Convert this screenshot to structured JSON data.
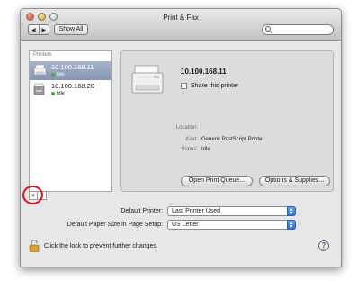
{
  "window": {
    "title": "Print & Fax"
  },
  "toolbar": {
    "back_icon": "chevron-left-icon",
    "forward_icon": "chevron-right-icon",
    "back_glyph": "◀",
    "forward_glyph": "▶",
    "show_all_label": "Show All",
    "search_placeholder": "",
    "search_icon": "magnifier-icon"
  },
  "printers": {
    "header": "Printers",
    "items": [
      {
        "name": "10.100.168.11",
        "status": "Idle",
        "selected": true
      },
      {
        "name": "10.100.168.20",
        "status": "Idle",
        "selected": false
      }
    ],
    "add_label": "+",
    "remove_label": "-"
  },
  "detail": {
    "printer_name": "10.100.168.11",
    "share_label": "Share this printer",
    "share_checked": false,
    "location_label": "Location:",
    "location_value": "",
    "kind_label": "Kind:",
    "kind_value": "Generic PostScript Printer",
    "status_label": "Status:",
    "status_value": "Idle",
    "open_queue_label": "Open Print Queue...",
    "options_label": "Options & Supplies..."
  },
  "defaults": {
    "default_printer_label": "Default Printer:",
    "default_printer_value": "Last Printer Used",
    "paper_size_label": "Default Paper Size in Page Setup:",
    "paper_size_value": "US Letter"
  },
  "footer": {
    "lock_text": "Click the lock to prevent further changes.",
    "help_label": "?"
  },
  "colors": {
    "selection": "#8c9bb8",
    "idle_dot": "#3fb23f",
    "highlight_circle": "#d9141c",
    "popup_arrow": "#2f6ed6"
  }
}
